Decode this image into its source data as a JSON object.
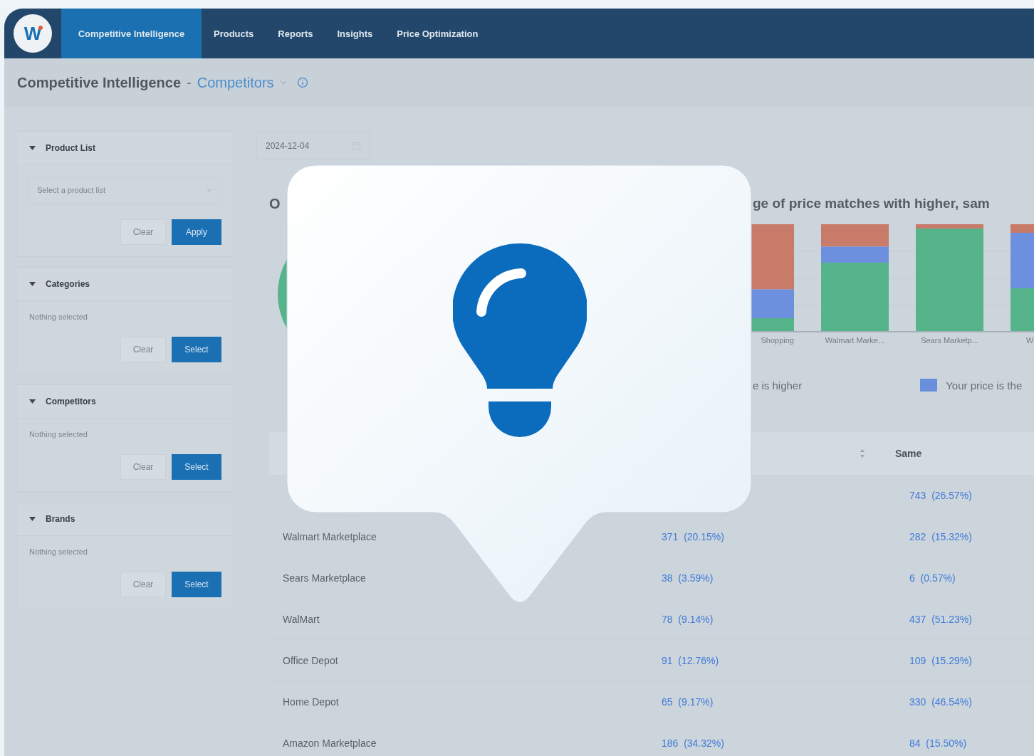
{
  "nav": {
    "logo": "W",
    "tabs": [
      {
        "label": "Competitive Intelligence",
        "selected": true
      },
      {
        "label": "Products",
        "selected": false
      },
      {
        "label": "Reports",
        "selected": false
      },
      {
        "label": "Insights",
        "selected": false
      },
      {
        "label": "Price Optimization",
        "selected": false
      }
    ]
  },
  "breadcrumb": {
    "section": "Competitive Intelligence",
    "separator": "-",
    "page": "Competitors"
  },
  "sidebar": {
    "sections": [
      {
        "title": "Product List",
        "kind": "dropdown",
        "placeholder": "Select a product list",
        "buttons": [
          "Clear",
          "Apply"
        ]
      },
      {
        "title": "Categories",
        "kind": "summary",
        "summary": "Nothing selected",
        "buttons": [
          "Clear",
          "Select"
        ]
      },
      {
        "title": "Competitors",
        "kind": "summary",
        "summary": "Nothing selected",
        "buttons": [
          "Clear",
          "Select"
        ]
      },
      {
        "title": "Brands",
        "kind": "summary",
        "summary": "Nothing selected",
        "buttons": [
          "Clear",
          "Select"
        ]
      }
    ]
  },
  "date_field": {
    "value": "2024-12-04"
  },
  "left_panel": {
    "heading": "O"
  },
  "right_panel": {
    "title": "ge of price matches with higher, sam",
    "bar_labels": [
      "Shopping",
      "Walmart Marke...",
      "Sears Marketp...",
      "W"
    ],
    "legend": [
      {
        "label": "e is higher"
      },
      {
        "label": "Your price is the",
        "color": "#6a90dd"
      }
    ]
  },
  "table": {
    "column_3": "Same",
    "rows": [
      {
        "same": "743  (26.57%)"
      },
      {
        "name": "Walmart Marketplace",
        "column_2": "371  (20.15%)",
        "same": "282  (15.32%)"
      },
      {
        "name": "Sears Marketplace",
        "column_2": "38  (3.59%)",
        "same": "6  (0.57%)"
      },
      {
        "name": "WalMart",
        "column_2": "78  (9.14%)",
        "same": "437  (51.23%)"
      },
      {
        "name": "Office Depot",
        "column_2": "91  (12.76%)",
        "same": "109  (15.29%)"
      },
      {
        "name": "Home Depot",
        "column_2": "65  (9.17%)",
        "same": "330  (46.54%)"
      },
      {
        "name": "Amazon Marketplace",
        "column_2": "186  (34.32%)",
        "same": "84  (15.50%)"
      }
    ]
  }
}
